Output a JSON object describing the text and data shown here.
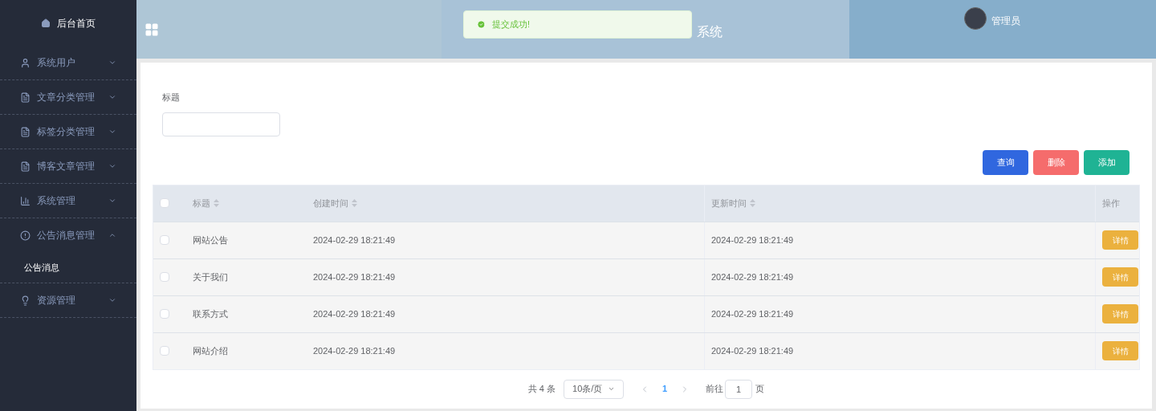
{
  "sidebar": {
    "home": {
      "label": "后台首页"
    },
    "items": [
      {
        "label": "系统用户",
        "expanded": false
      },
      {
        "label": "文章分类管理",
        "expanded": false
      },
      {
        "label": "标签分类管理",
        "expanded": false
      },
      {
        "label": "博客文章管理",
        "expanded": false
      },
      {
        "label": "系统管理",
        "expanded": false
      },
      {
        "label": "公告消息管理",
        "expanded": true,
        "children": [
          {
            "label": "公告消息",
            "selected": true
          }
        ]
      },
      {
        "label": "资源管理",
        "expanded": false
      }
    ]
  },
  "header": {
    "title": "系统",
    "user": "管理员"
  },
  "toast": {
    "message": "提交成功!"
  },
  "filter": {
    "label": "标题"
  },
  "actions": [
    {
      "label": "查询",
      "kind": "query"
    },
    {
      "label": "删除",
      "kind": "delete"
    },
    {
      "label": "添加",
      "kind": "add"
    }
  ],
  "table": {
    "all_checked": false,
    "columns": [
      "标题",
      "创建时间",
      "更新时间",
      "操作"
    ],
    "rows": [
      {
        "checked": false,
        "title": "网站公告",
        "created": "2024-02-29 18:21:49",
        "updated": "2024-02-29 18:21:49",
        "action": "详情"
      },
      {
        "checked": false,
        "title": "关于我们",
        "created": "2024-02-29 18:21:49",
        "updated": "2024-02-29 18:21:49",
        "action": "详情"
      },
      {
        "checked": false,
        "title": "联系方式",
        "created": "2024-02-29 18:21:49",
        "updated": "2024-02-29 18:21:49",
        "action": "详情"
      },
      {
        "checked": false,
        "title": "网站介绍",
        "created": "2024-02-29 18:21:49",
        "updated": "2024-02-29 18:21:49",
        "action": "详情"
      }
    ]
  },
  "pagination": {
    "total": "共 4 条",
    "page_size": "10条/页",
    "pages": [
      {
        "label": "1",
        "selected": true
      }
    ],
    "goto_label": "前往",
    "goto_value": "1",
    "goto_suffix": "页"
  }
}
